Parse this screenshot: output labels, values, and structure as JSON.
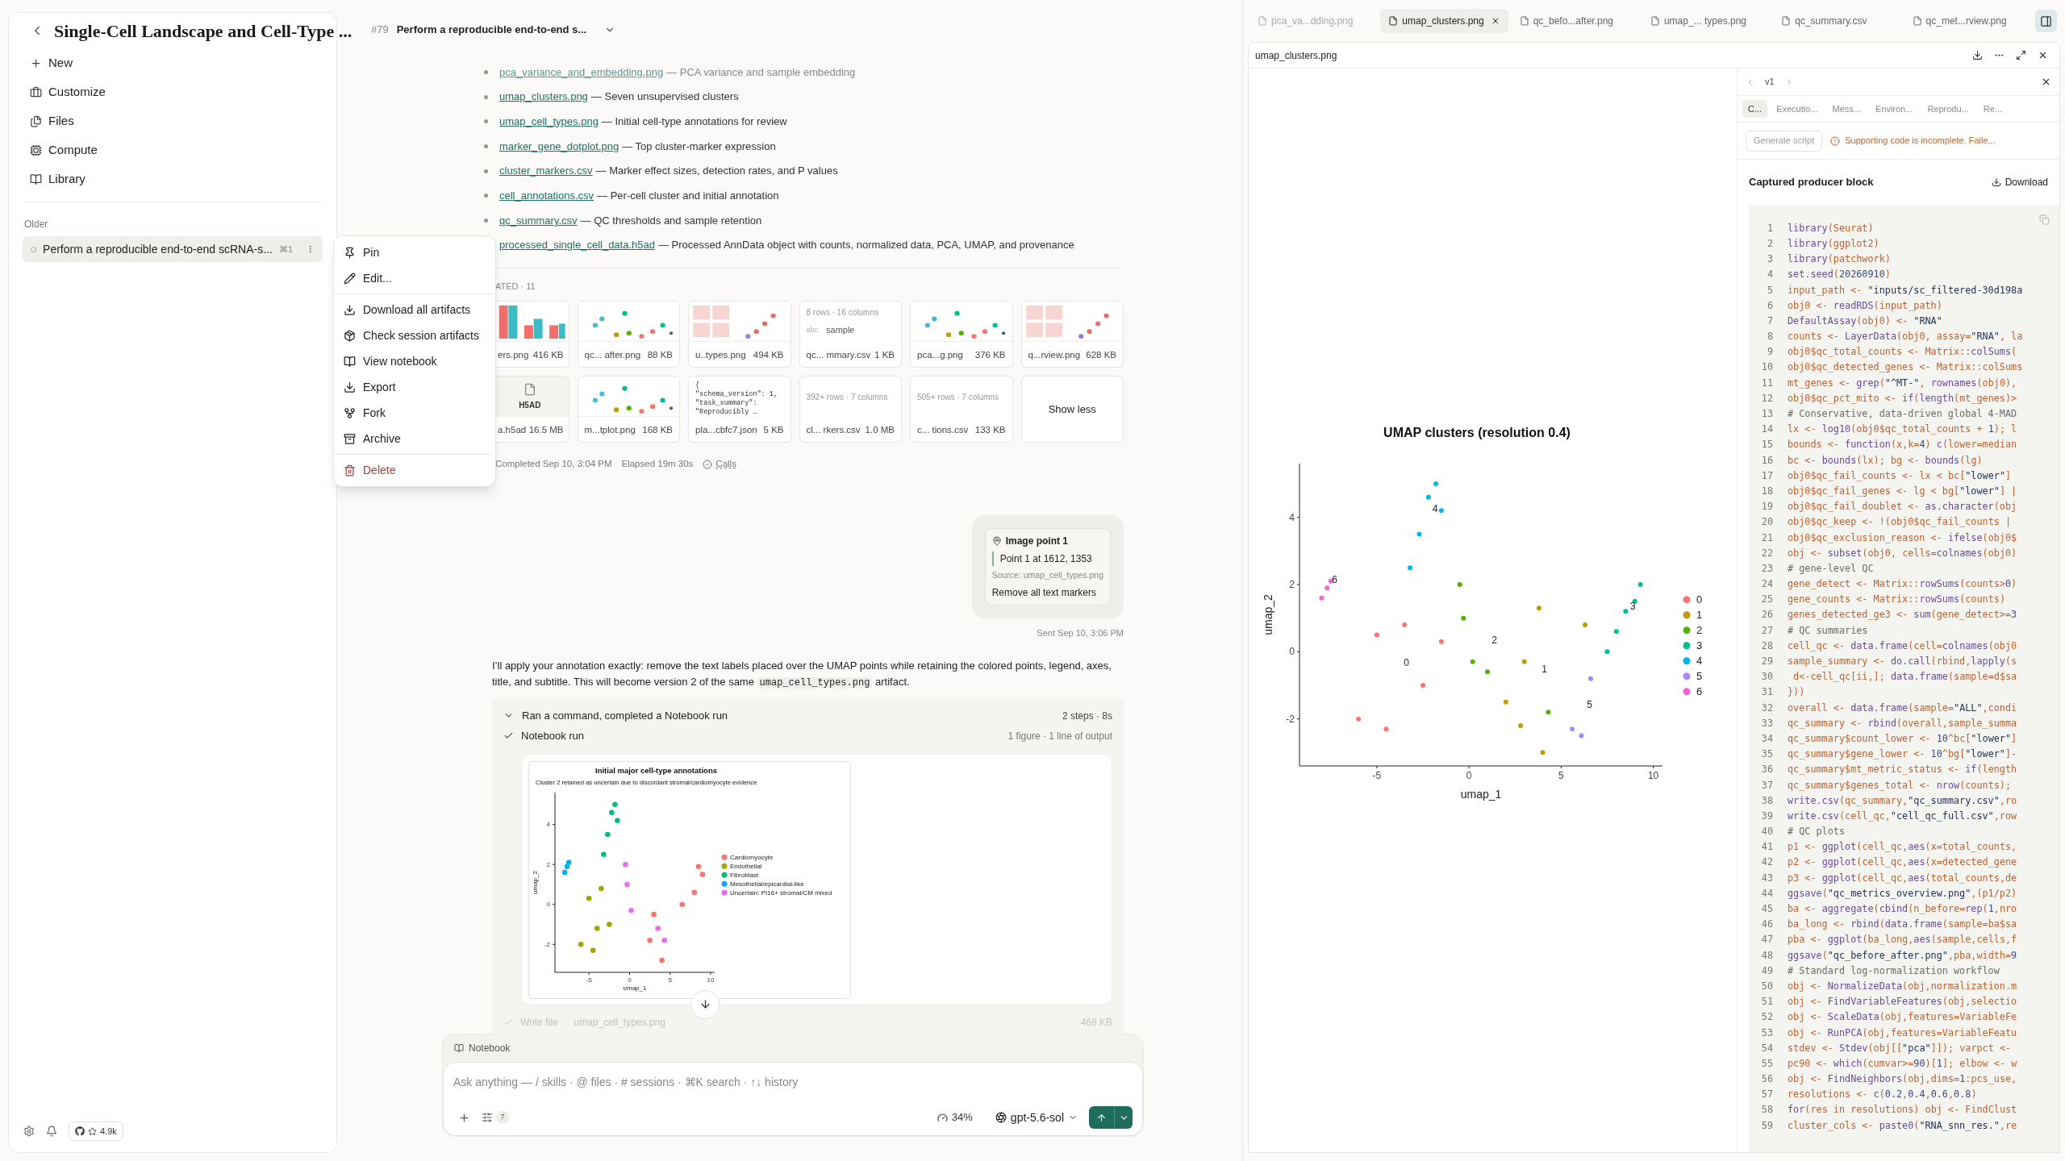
{
  "sidebar": {
    "title": "Single-Cell Landscape and Cell-Type ...",
    "nav": [
      {
        "label": "New",
        "kind": "new"
      },
      {
        "label": "Customize",
        "kind": "customize"
      },
      {
        "label": "Files",
        "kind": "files"
      },
      {
        "label": "Compute",
        "kind": "compute"
      },
      {
        "label": "Library",
        "kind": "library"
      }
    ],
    "section": "Older",
    "sessions": [
      {
        "title": "Perform a reproducible end-to-end scRNA-s...",
        "shortcut": "⌘1",
        "selected": true
      }
    ],
    "github_label": "4.9k"
  },
  "context_menu": {
    "items": [
      {
        "kind": "pin",
        "label": "Pin"
      },
      {
        "kind": "edit",
        "label": "Edit..."
      },
      {
        "kind": "divider"
      },
      {
        "kind": "download",
        "label": "Download all artifacts"
      },
      {
        "kind": "check",
        "label": "Check session artifacts"
      },
      {
        "kind": "notebook",
        "label": "View notebook"
      },
      {
        "kind": "export",
        "label": "Export"
      },
      {
        "kind": "fork",
        "label": "Fork"
      },
      {
        "kind": "archive",
        "label": "Archive"
      },
      {
        "kind": "divider"
      },
      {
        "kind": "delete",
        "label": "Delete"
      }
    ]
  },
  "thread": {
    "number": "#79",
    "title": "Perform a reproducible end-to-end s...",
    "artifacts": [
      {
        "file": "pca_variance_and_embedding.png",
        "description": "— PCA variance and sample embedding",
        "faded": true
      },
      {
        "file": "umap_clusters.png",
        "description": "— Seven unsupervised clusters",
        "faded": false
      },
      {
        "file": "umap_cell_types.png",
        "description": "— Initial cell-type annotations for review",
        "faded": false
      },
      {
        "file": "marker_gene_dotplot.png",
        "description": "— Top cluster-marker expression",
        "faded": false
      },
      {
        "file": "cluster_markers.csv",
        "description": "— Marker effect sizes, detection rates, and P values",
        "faded": false
      },
      {
        "file": "cell_annotations.csv",
        "description": "— Per-cell cluster and initial annotation",
        "faded": false
      },
      {
        "file": "qc_summary.csv",
        "description": "— QC thresholds and sample retention",
        "faded": false
      },
      {
        "file": "processed_single_cell_data.h5ad",
        "description": "— Processed AnnData object with counts, normalized data, PCA, UMAP, and provenance",
        "faded": false
      }
    ],
    "generated_label": "ATED · 11",
    "cards": [
      {
        "name": "ers.png",
        "size": "416 KB"
      },
      {
        "name": "qc... after.png",
        "size": "88 KB"
      },
      {
        "name": "u..types.png",
        "size": "494 KB"
      },
      {
        "kind": "table",
        "meta": "8 rows · 16 columns",
        "type": "abc",
        "column": "sample",
        "name": "qc... mmary.csv",
        "size": "1 KB"
      },
      {
        "name": "pca...g.png",
        "size": "376 KB"
      },
      {
        "name": "q...rview.png",
        "size": "628 KB"
      },
      {
        "kind": "file",
        "badge": "H5AD",
        "name": "a.h5ad",
        "size": "16.5 MB"
      },
      {
        "name": "m...tplot.png",
        "size": "168 KB"
      },
      {
        "kind": "json",
        "preview": "{\n\"schema_version\": 1,\n\"task_summary\":\n\"Reproducibly …",
        "name": "pla...cbfc7.json",
        "size": "5 KB"
      },
      {
        "kind": "table",
        "meta": "392+ rows · 7 columns",
        "name": "cl... rkers.csv",
        "size": "1.0 MB"
      },
      {
        "kind": "table",
        "meta": "505+ rows · 7 columns",
        "name": "c... tions.csv",
        "size": "133 KB"
      }
    ],
    "show_less": "Show less",
    "completed": "Completed Sep 10, 3:04 PM",
    "elapsed": "Elapsed 19m 30s",
    "calls": "Calls",
    "user_message": {
      "title": "Image point 1",
      "point": "Point 1 at 1612, 1353",
      "source": "Source: umap_cell_types.png",
      "instruction": "Remove all text markers",
      "sent": "Sent Sep 10, 3:06 PM"
    },
    "reply": {
      "before": "I’ll apply your annotation exactly: remove the text labels placed over the UMAP points while retaining the colored points, legend, axes, title, and subtitle. This will become version 2 of the same",
      "code": "umap_cell_types.png",
      "after": "artifact."
    },
    "steps": {
      "summary": "Ran a command, completed a Notebook run",
      "expanded": true,
      "meta": "2 steps · 8s",
      "run": {
        "label": "Notebook run",
        "meta": "1 figure · 1 line of output"
      },
      "figure": {
        "subtitle": "Cluster 2 retained as uncertain due to discordant stromal/cardiomyocyte evidence",
        "chart_data": {
          "type": "scatter",
          "legend": "right",
          "title": "Initial major cell-type annotations",
          "xlabel": "umap_1",
          "ylabel": "umap_2",
          "xlim": [
            -9.2,
            10.5
          ],
          "ylim": [
            -3.4,
            5.6
          ],
          "xticks": [
            -5,
            0,
            5,
            10
          ],
          "yticks": [
            -2,
            0,
            2,
            4
          ],
          "x": [
            3,
            4,
            2.5,
            6.5,
            8,
            9,
            8.5,
            -6,
            -5,
            -4.5,
            -3.5,
            -2.5,
            -4,
            -3.2,
            -2.7,
            -2.2,
            -1.8,
            -1.5,
            -8,
            -7.7,
            -7.5,
            -0.5,
            -0.3,
            0.2,
            3.5,
            4.3
          ],
          "series": [
            {
              "name": "Cardiomyocyte",
              "color": "#f8766d",
              "values": [
                -0.5,
                -2.8,
                -1.8,
                0,
                0.6,
                1.5,
                1.9,
                null,
                null,
                null,
                null,
                null,
                null,
                null,
                null,
                null,
                null,
                null,
                null,
                null,
                null,
                null,
                null,
                null,
                null,
                null
              ]
            },
            {
              "name": "Endothelial",
              "color": "#a3a500",
              "values": [
                null,
                null,
                null,
                null,
                null,
                null,
                null,
                -2,
                0.3,
                -2.3,
                0.8,
                -1,
                -1.2,
                null,
                null,
                null,
                null,
                null,
                null,
                null,
                null,
                null,
                null,
                null,
                null,
                null
              ]
            },
            {
              "name": "Fibroblast",
              "color": "#00bf7d",
              "values": [
                null,
                null,
                null,
                null,
                null,
                null,
                null,
                null,
                null,
                null,
                null,
                null,
                null,
                2.5,
                3.5,
                4.6,
                5,
                4.2,
                null,
                null,
                null,
                null,
                null,
                null,
                null,
                null
              ]
            },
            {
              "name": "Mesothelial/epicardial-like",
              "color": "#00b0f6",
              "values": [
                null,
                null,
                null,
                null,
                null,
                null,
                null,
                null,
                null,
                null,
                null,
                null,
                null,
                null,
                null,
                null,
                null,
                null,
                1.6,
                1.9,
                2.1,
                null,
                null,
                null,
                null,
                null
              ]
            },
            {
              "name": "Uncertain: PI16+ stromal/CM mixed",
              "color": "#e76bf3",
              "values": [
                null,
                null,
                null,
                null,
                null,
                null,
                null,
                null,
                null,
                null,
                null,
                null,
                null,
                null,
                null,
                null,
                null,
                null,
                null,
                null,
                null,
                2,
                1,
                -0.3,
                -1.2,
                -1.8
              ]
            }
          ]
        }
      },
      "write": {
        "label": "Write file",
        "file": "umap_cell_types.png",
        "size": "468 KB"
      }
    },
    "composer": {
      "context": "Notebook",
      "placeholder": "Ask anything — / skills · @ files · # sessions · ⌘K search · ↑↓ history",
      "tools_count": "7",
      "usage": "34%",
      "model": "gpt-5.6-sol"
    }
  },
  "viewer": {
    "tabs": [
      {
        "label": "pca_va...dding.png",
        "selected": false,
        "faded": true
      },
      {
        "label": "umap_clusters.png",
        "selected": true,
        "faded": false
      },
      {
        "label": "qc_befo...after.png",
        "selected": false,
        "faded": false
      },
      {
        "label": "umap_... types.png",
        "selected": false,
        "faded": false
      },
      {
        "label": "qc_summary.csv",
        "selected": false,
        "faded": false
      },
      {
        "label": "qc_met...rview.png",
        "selected": false,
        "faded": false
      }
    ],
    "file_title": "umap_clusters.png",
    "chart_data": {
      "type": "scatter",
      "legend": "right",
      "title": "UMAP clusters (resolution 0.4)",
      "xlabel": "umap_1",
      "ylabel": "umap_2",
      "xlim": [
        -9.2,
        10.5
      ],
      "ylim": [
        -3.4,
        5.6
      ],
      "xticks": [
        -5,
        0,
        5,
        10
      ],
      "yticks": [
        -2,
        0,
        2,
        4
      ],
      "x": [
        -6,
        -5,
        -4.5,
        -3.5,
        -2.5,
        -1.5,
        2,
        3,
        4,
        3.8,
        6.3,
        2.8,
        -0.5,
        -0.3,
        0.2,
        1,
        4.3,
        7.5,
        8,
        8.5,
        9,
        9.3,
        -3.2,
        -2.7,
        -2.2,
        -1.8,
        -1.5,
        5.6,
        6.1,
        6.6,
        -8,
        -7.7,
        -7.5
      ],
      "series": [
        {
          "name": "0",
          "color": "#f8766d",
          "values": [
            -2,
            0.5,
            -2.3,
            0.8,
            -1,
            0.3,
            null,
            null,
            null,
            null,
            null,
            null,
            null,
            null,
            null,
            null,
            null,
            null,
            null,
            null,
            null,
            null,
            null,
            null,
            null,
            null,
            null,
            null,
            null,
            null,
            null,
            null,
            null
          ]
        },
        {
          "name": "1",
          "color": "#c49a00",
          "values": [
            null,
            null,
            null,
            null,
            null,
            null,
            -1.5,
            -0.3,
            -3,
            1.3,
            0.8,
            -2.2,
            null,
            null,
            null,
            null,
            null,
            null,
            null,
            null,
            null,
            null,
            null,
            null,
            null,
            null,
            null,
            null,
            null,
            null,
            null,
            null,
            null
          ]
        },
        {
          "name": "2",
          "color": "#53b400",
          "values": [
            null,
            null,
            null,
            null,
            null,
            null,
            null,
            null,
            null,
            null,
            null,
            null,
            2,
            1,
            -0.3,
            -0.6,
            -1.8,
            null,
            null,
            null,
            null,
            null,
            null,
            null,
            null,
            null,
            null,
            null,
            null,
            null,
            null,
            null,
            null
          ]
        },
        {
          "name": "3",
          "color": "#00c094",
          "values": [
            null,
            null,
            null,
            null,
            null,
            null,
            null,
            null,
            null,
            null,
            null,
            null,
            null,
            null,
            null,
            null,
            null,
            0,
            0.6,
            1.2,
            1.5,
            2,
            null,
            null,
            null,
            null,
            null,
            null,
            null,
            null,
            null,
            null,
            null
          ]
        },
        {
          "name": "4",
          "color": "#00b6eb",
          "values": [
            null,
            null,
            null,
            null,
            null,
            null,
            null,
            null,
            null,
            null,
            null,
            null,
            null,
            null,
            null,
            null,
            null,
            null,
            null,
            null,
            null,
            null,
            2.5,
            3.5,
            4.6,
            5,
            4.2,
            null,
            null,
            null,
            null,
            null,
            null
          ]
        },
        {
          "name": "5",
          "color": "#a58aff",
          "values": [
            null,
            null,
            null,
            null,
            null,
            null,
            null,
            null,
            null,
            null,
            null,
            null,
            null,
            null,
            null,
            null,
            null,
            null,
            null,
            null,
            null,
            null,
            null,
            null,
            null,
            null,
            null,
            -2.3,
            -2.5,
            -0.8,
            null,
            null,
            null
          ]
        },
        {
          "name": "6",
          "color": "#fb61d7",
          "values": [
            null,
            null,
            null,
            null,
            null,
            null,
            null,
            null,
            null,
            null,
            null,
            null,
            null,
            null,
            null,
            null,
            null,
            null,
            null,
            null,
            null,
            null,
            null,
            null,
            null,
            null,
            null,
            null,
            null,
            null,
            1.6,
            1.9,
            2.1
          ]
        }
      ],
      "annotations": [
        "0",
        "1",
        "2",
        "3",
        "4",
        "5",
        "6"
      ]
    },
    "inspector": {
      "version": "v1",
      "tabs": [
        {
          "label": "C...",
          "selected": true
        },
        {
          "label": "Executio...",
          "selected": false
        },
        {
          "label": "Mess...",
          "selected": false
        },
        {
          "label": "Environ...",
          "selected": false
        },
        {
          "label": "Reprodu...",
          "selected": false
        },
        {
          "label": "Re...",
          "selected": false
        }
      ],
      "generate": "Generate script",
      "warning": "Supporting code is incomplete. Faile...",
      "block_title": "Captured producer block",
      "download": "Download",
      "code": [
        {
          "number": "1",
          "text": "library(Seurat)"
        },
        {
          "number": "2",
          "text": "library(ggplot2)"
        },
        {
          "number": "3",
          "text": "library(patchwork)"
        },
        {
          "number": "4",
          "text": "set.seed(20260910)"
        },
        {
          "number": "5",
          "text": "input_path <- \"inputs/sc_filtered-30d198a"
        },
        {
          "number": "6",
          "text": "obj0 <- readRDS(input_path)"
        },
        {
          "number": "7",
          "text": "DefaultAssay(obj0) <- \"RNA\""
        },
        {
          "number": "8",
          "text": "counts <- LayerData(obj0, assay=\"RNA\", la"
        },
        {
          "number": "9",
          "text": "obj0$qc_total_counts <- Matrix::colSums("
        },
        {
          "number": "10",
          "text": "obj0$qc_detected_genes <- Matrix::colSums"
        },
        {
          "number": "11",
          "text": "mt_genes <- grep(\"^MT-\", rownames(obj0),"
        },
        {
          "number": "12",
          "text": "obj0$qc_pct_mito <- if(length(mt_genes)>"
        },
        {
          "number": "13",
          "text": "# Conservative, data-driven global 4-MAD"
        },
        {
          "number": "14",
          "text": "lx <- log10(obj0$qc_total_counts + 1); l"
        },
        {
          "number": "15",
          "text": "bounds <- function(x,k=4) c(lower=median"
        },
        {
          "number": "16",
          "text": "bc <- bounds(lx); bg <- bounds(lg)"
        },
        {
          "number": "17",
          "text": "obj0$qc_fail_counts <- lx < bc[\"lower\"]"
        },
        {
          "number": "18",
          "text": "obj0$qc_fail_genes <- lg < bg[\"lower\"] |"
        },
        {
          "number": "19",
          "text": "obj0$qc_fail_doublet <- as.character(obj"
        },
        {
          "number": "20",
          "text": "obj0$qc_keep <- !(obj0$qc_fail_counts |"
        },
        {
          "number": "21",
          "text": "obj0$qc_exclusion_reason <- ifelse(obj0$"
        },
        {
          "number": "22",
          "text": "obj <- subset(obj0, cells=colnames(obj0)"
        },
        {
          "number": "23",
          "text": "# gene-level QC"
        },
        {
          "number": "24",
          "text": "gene_detect <- Matrix::rowSums(counts>0)"
        },
        {
          "number": "25",
          "text": "gene_counts <- Matrix::rowSums(counts)"
        },
        {
          "number": "26",
          "text": "genes_detected_ge3 <- sum(gene_detect>=3"
        },
        {
          "number": "27",
          "text": "# QC summaries"
        },
        {
          "number": "28",
          "text": "cell_qc <- data.frame(cell=colnames(obj0"
        },
        {
          "number": "29",
          "text": "sample_summary <- do.call(rbind,lapply(s"
        },
        {
          "number": "30",
          "text": " d<-cell_qc[ii,]; data.frame(sample=d$sa"
        },
        {
          "number": "31",
          "text": "}))"
        },
        {
          "number": "32",
          "text": "overall <- data.frame(sample=\"ALL\",condi"
        },
        {
          "number": "33",
          "text": "qc_summary <- rbind(overall,sample_summa"
        },
        {
          "number": "34",
          "text": "qc_summary$count_lower <- 10^bc[\"lower\"]"
        },
        {
          "number": "35",
          "text": "qc_summary$gene_lower <- 10^bg[\"lower\"]-"
        },
        {
          "number": "36",
          "text": "qc_summary$mt_metric_status <- if(length"
        },
        {
          "number": "37",
          "text": "qc_summary$genes_total <- nrow(counts);"
        },
        {
          "number": "38",
          "text": "write.csv(qc_summary,\"qc_summary.csv\",ro"
        },
        {
          "number": "39",
          "text": "write.csv(cell_qc,\"cell_qc_full.csv\",row"
        },
        {
          "number": "40",
          "text": "# QC plots"
        },
        {
          "number": "41",
          "text": "p1 <- ggplot(cell_qc,aes(x=total_counts,"
        },
        {
          "number": "42",
          "text": "p2 <- ggplot(cell_qc,aes(x=detected_gene"
        },
        {
          "number": "43",
          "text": "p3 <- ggplot(cell_qc,aes(total_counts,de"
        },
        {
          "number": "44",
          "text": "ggsave(\"qc_metrics_overview.png\",(p1/p2)"
        },
        {
          "number": "45",
          "text": "ba <- aggregate(cbind(n_before=rep(1,nro"
        },
        {
          "number": "46",
          "text": "ba_long <- rbind(data.frame(sample=ba$sa"
        },
        {
          "number": "47",
          "text": "pba <- ggplot(ba_long,aes(sample,cells,f"
        },
        {
          "number": "48",
          "text": "ggsave(\"qc_before_after.png\",pba,width=9"
        },
        {
          "number": "49",
          "text": "# Standard log-normalization workflow"
        },
        {
          "number": "50",
          "text": "obj <- NormalizeData(obj,normalization.m"
        },
        {
          "number": "51",
          "text": "obj <- FindVariableFeatures(obj,selectio"
        },
        {
          "number": "52",
          "text": "obj <- ScaleData(obj,features=VariableFe"
        },
        {
          "number": "53",
          "text": "obj <- RunPCA(obj,features=VariableFeatu"
        },
        {
          "number": "54",
          "text": "stdev <- Stdev(obj[[\"pca\"]]); varpct <-"
        },
        {
          "number": "55",
          "text": "pc90 <- which(cumvar>=90)[1]; elbow <- w"
        },
        {
          "number": "56",
          "text": "obj <- FindNeighbors(obj,dims=1:pcs_use,"
        },
        {
          "number": "57",
          "text": "resolutions <- c(0.2,0.4,0.6,0.8)"
        },
        {
          "number": "58",
          "text": "for(res in resolutions) obj <- FindClust"
        },
        {
          "number": "59",
          "text": "cluster_cols <- paste0(\"RNA_snn_res.\",re"
        }
      ]
    }
  }
}
